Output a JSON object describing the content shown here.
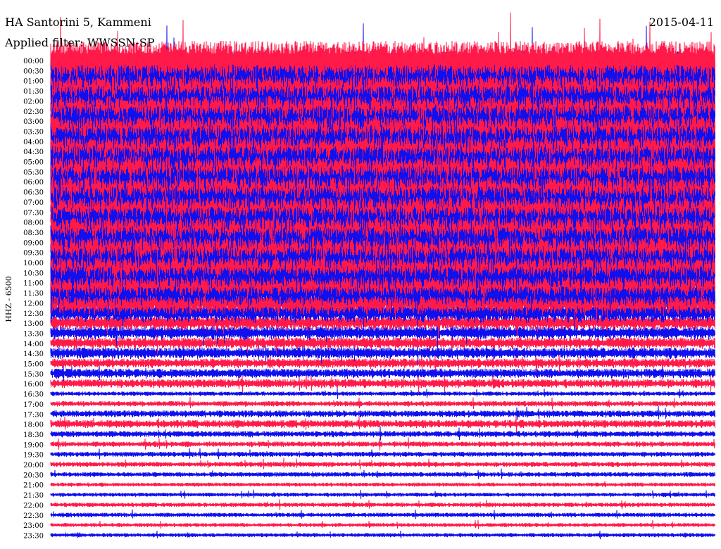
{
  "header": {
    "station": "HA Santorini 5, Kammeni",
    "filter": "Applied filter: WWSSN-SP",
    "date": "2015-04-11"
  },
  "chart_data": {
    "type": "line",
    "title": "HA Santorini 5, Kammeni",
    "subtitle": "Applied filter: WWSSN-SP",
    "date": "2015-04-11",
    "ylabel": "HHZ - 6500",
    "row_labels": [
      "00:00",
      "00:30",
      "01:00",
      "01:30",
      "02:00",
      "02:30",
      "03:00",
      "03:30",
      "04:00",
      "04:30",
      "05:00",
      "05:30",
      "06:00",
      "06:30",
      "07:00",
      "07:30",
      "08:00",
      "08:30",
      "09:00",
      "09:30",
      "10:00",
      "10:30",
      "11:00",
      "11:30",
      "12:00",
      "12:30",
      "13:00",
      "13:30",
      "14:00",
      "14:30",
      "15:00",
      "15:30",
      "16:00",
      "16:30",
      "17:00",
      "17:30",
      "18:00",
      "18:30",
      "19:00",
      "19:30",
      "20:00",
      "20:30",
      "21:00",
      "21:30",
      "22:00",
      "22:30",
      "23:00",
      "23:30"
    ],
    "series_colors": [
      "#ff1a4a",
      "#1010ee"
    ],
    "relative_activity": [
      1.0,
      1.0,
      1.0,
      1.0,
      1.0,
      1.0,
      1.0,
      1.0,
      1.0,
      1.0,
      1.0,
      1.0,
      1.0,
      1.0,
      1.0,
      1.0,
      1.0,
      1.0,
      1.0,
      0.9,
      0.85,
      0.85,
      0.75,
      0.7,
      0.65,
      0.5,
      0.35,
      0.3,
      0.25,
      0.25,
      0.2,
      0.2,
      0.18,
      0.05,
      0.08,
      0.12,
      0.15,
      0.1,
      0.08,
      0.07,
      0.07,
      0.06,
      0.04,
      0.04,
      0.05,
      0.05,
      0.04,
      0.04
    ]
  }
}
